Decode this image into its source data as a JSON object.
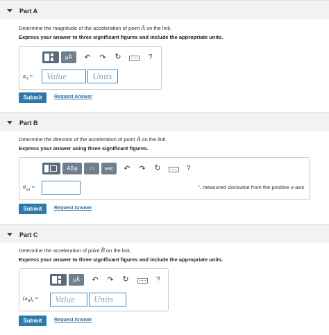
{
  "partA": {
    "title": "Part A",
    "question_prefix": "Determine the magnitude of the acceleration of point ",
    "question_var": "A",
    "question_suffix": " on the link.",
    "instruction": "Express your answer to three significant figures and include the appropriate units.",
    "toolbar": {
      "units_btn": "μÅ",
      "help": "?"
    },
    "label_var": "a",
    "label_sub": "A",
    "label_eq": " =",
    "value_placeholder": "Value",
    "units_placeholder": "Units",
    "submit": "Submit",
    "request": "Request Answer"
  },
  "partB": {
    "title": "Part B",
    "question_prefix": "Determine the direction of the acceleration of point ",
    "question_var": "A",
    "question_suffix": " on the link.",
    "instruction": "Express your answer using three significant figures.",
    "toolbar": {
      "greek_btn": "ΑΣφ",
      "arrows_btn": "↓↑",
      "vec_btn": "vec",
      "help": "?"
    },
    "label_var": "θ",
    "label_sub": "aA",
    "label_eq": " =",
    "suffix_text_1": "°, measured clockwise from the positive ",
    "suffix_var": "x",
    "suffix_text_2": "-axis",
    "submit": "Submit",
    "request": "Request Answer"
  },
  "partC": {
    "title": "Part C",
    "question_prefix": "Determine the acceleration of point ",
    "question_var": "B",
    "question_suffix": " on the link.",
    "instruction": "Express your answer to three significant figures and include the appropriate units.",
    "toolbar": {
      "units_btn": "μÅ",
      "help": "?"
    },
    "label_open": "(",
    "label_var": "a",
    "label_sub": "B",
    "label_close": ")",
    "label_sub2": "x",
    "label_eq": " =",
    "value_placeholder": "Value",
    "units_placeholder": "Units",
    "submit": "Submit",
    "request": "Request Answer"
  }
}
